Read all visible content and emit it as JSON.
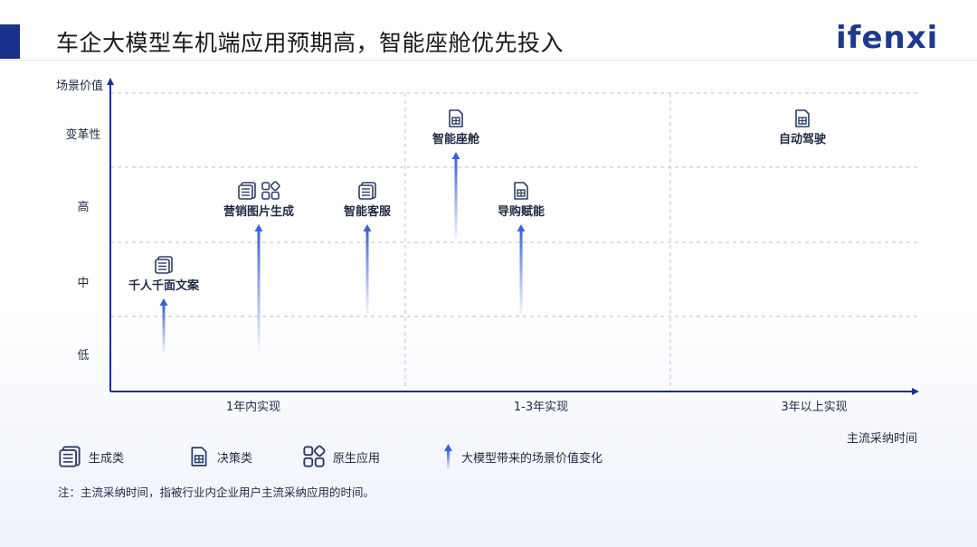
{
  "header": {
    "title": "车企大模型车机端应用预期高，智能座舱优先投入",
    "logo": "ifenxi"
  },
  "axes": {
    "y_title": "场景价值",
    "x_title": "主流采纳时间",
    "y_levels": [
      "变革性",
      "高",
      "中",
      "低"
    ],
    "x_columns": [
      "1年内实现",
      "1-3年实现",
      "3年以上实现"
    ]
  },
  "nodes": [
    {
      "label": "千人千面文案",
      "types": [
        "生成类"
      ],
      "column": "1年内实现",
      "value_level": "中",
      "arrow_start_level": "低"
    },
    {
      "label": "营销图片生成",
      "types": [
        "生成类",
        "原生应用"
      ],
      "column": "1年内实现",
      "value_level": "高",
      "arrow_start_level": "低"
    },
    {
      "label": "智能客服",
      "types": [
        "生成类"
      ],
      "column": "1年内实现",
      "value_level": "高",
      "arrow_start_level": "中"
    },
    {
      "label": "智能座舱",
      "types": [
        "决策类"
      ],
      "column": "1-3年实现",
      "value_level": "变革性",
      "arrow_start_level": "高"
    },
    {
      "label": "导购赋能",
      "types": [
        "决策类"
      ],
      "column": "1-3年实现",
      "value_level": "高",
      "arrow_start_level": "中"
    },
    {
      "label": "自动驾驶",
      "types": [
        "决策类"
      ],
      "column": "3年以上实现",
      "value_level": "变革性",
      "arrow_start_level": null
    }
  ],
  "legend": {
    "generative": "生成类",
    "decision": "决策类",
    "native": "原生应用",
    "arrow": "大模型带来的场景价值变化"
  },
  "note": "注：主流采纳时间，指被行业内企业用户主流采纳应用的时间。",
  "colors": {
    "primary": "#17318c",
    "icon": "#2c3e66",
    "arrow": "#3a63d9"
  }
}
